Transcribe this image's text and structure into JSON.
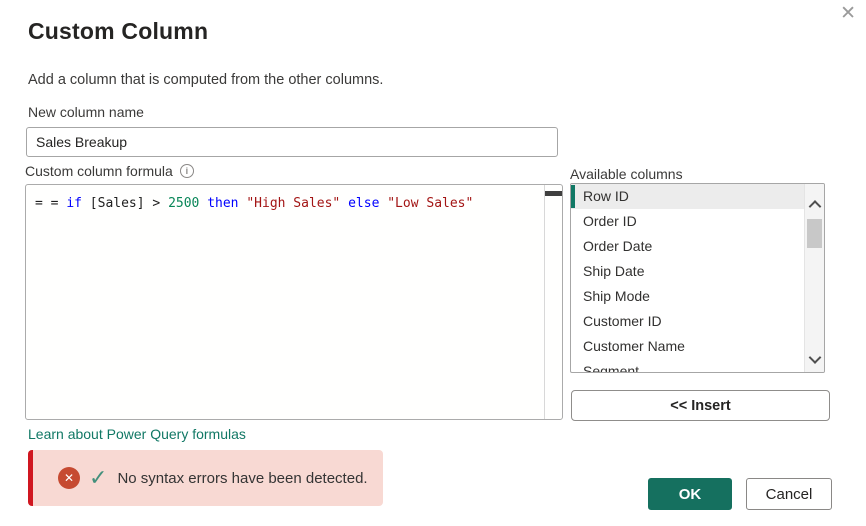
{
  "dialog": {
    "title": "Custom Column",
    "subtitle": "Add a column that is computed from the other columns."
  },
  "icons": {
    "close_glyph": "✕",
    "info_glyph": "i",
    "error_glyph": "✕",
    "check_glyph": "✓"
  },
  "new_column": {
    "label": "New column name",
    "value": "Sales Breakup"
  },
  "formula": {
    "label": "Custom column formula",
    "full_text": "= = if [Sales] > 2500 then \"High Sales\" else \"Low Sales\"",
    "tokens": [
      {
        "text": "= = ",
        "color": "#1e1e1e"
      },
      {
        "text": "if",
        "color": "#0000ff"
      },
      {
        "text": " [Sales] > ",
        "color": "#1e1e1e"
      },
      {
        "text": "2500",
        "color": "#098658"
      },
      {
        "text": " ",
        "color": "#1e1e1e"
      },
      {
        "text": "then",
        "color": "#0000ff"
      },
      {
        "text": " ",
        "color": "#1e1e1e"
      },
      {
        "text": "\"High Sales\"",
        "color": "#a31515"
      },
      {
        "text": " ",
        "color": "#1e1e1e"
      },
      {
        "text": "else",
        "color": "#0000ff"
      },
      {
        "text": " ",
        "color": "#1e1e1e"
      },
      {
        "text": "\"Low Sales\"",
        "color": "#a31515"
      }
    ]
  },
  "available_columns": {
    "label": "Available columns",
    "items": [
      "Row ID",
      "Order ID",
      "Order Date",
      "Ship Date",
      "Ship Mode",
      "Customer ID",
      "Customer Name",
      "Segment"
    ],
    "selected_index": 0
  },
  "insert_button": {
    "label": "<< Insert"
  },
  "link": {
    "label": "Learn about Power Query formulas"
  },
  "status": {
    "message": "No syntax errors have been detected."
  },
  "buttons": {
    "ok": "OK",
    "cancel": "Cancel"
  },
  "colors": {
    "accent_teal": "#117865",
    "ok_button": "#15705f",
    "status_background": "#f8d9d3",
    "status_left_bar": "#d01720",
    "error_icon": "#c64a31",
    "check_icon": "#44907c",
    "keyword_blue": "#0000ff",
    "number_green": "#098658",
    "string_red": "#a31515"
  }
}
